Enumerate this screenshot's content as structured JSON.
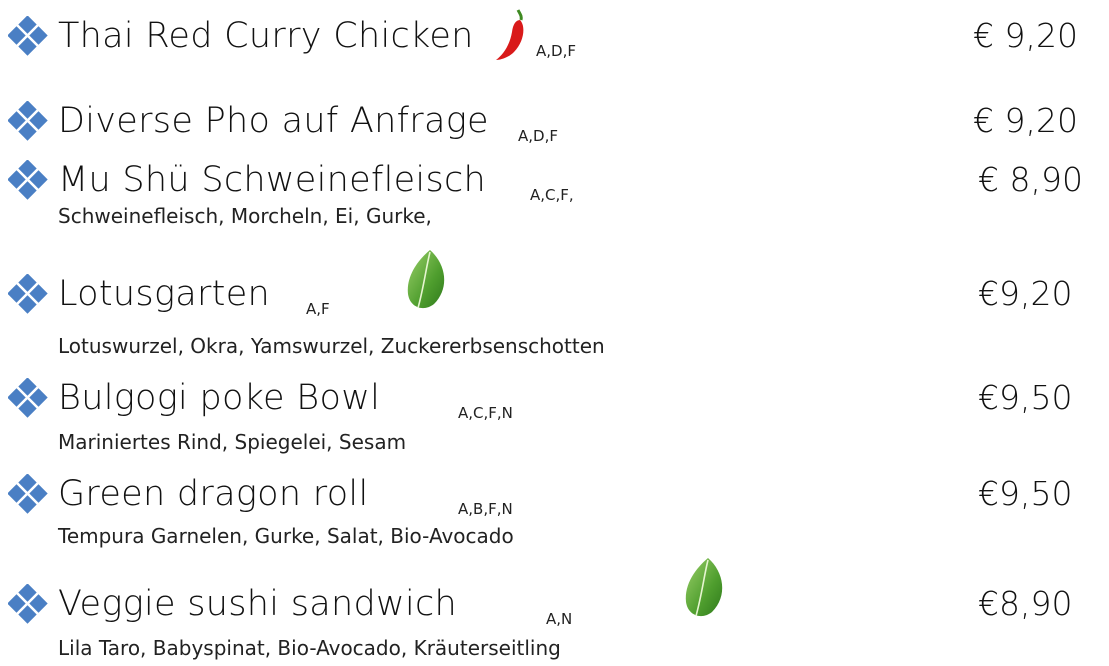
{
  "colors": {
    "bullet": "#4a7fc4",
    "chili": "#d91a1a",
    "leaf": "#5fae3a"
  },
  "items": [
    {
      "name": "Thai Red Curry Chicken",
      "allergens": "A,D,F",
      "price": "€ 9,20",
      "icon": "chili-icon"
    },
    {
      "name": "Diverse Pho auf Anfrage",
      "allergens": "A,D,F",
      "price": "€ 9,20"
    },
    {
      "name": "Mu Shü Schweinefleisch",
      "allergens": "A,C,F,",
      "price": "€ 8,90",
      "description": "Schweinefleisch, Morcheln, Ei, Gurke,"
    },
    {
      "name": "Lotusgarten",
      "allergens": "A,F",
      "price": "€9,20",
      "icon": "leaf-icon",
      "description": "Lotuswurzel, Okra, Yamswurzel, Zuckererbsenschotten"
    },
    {
      "name": "Bulgogi poke Bowl",
      "allergens": "A,C,F,N",
      "price": "€9,50",
      "description": "Mariniertes Rind, Spiegelei, Sesam"
    },
    {
      "name": "Green dragon roll",
      "allergens": "A,B,F,N",
      "price": "€9,50",
      "description": "Tempura Garnelen, Gurke, Salat, Bio-Avocado"
    },
    {
      "name": "Veggie sushi sandwich",
      "allergens": "A,N",
      "price": "€8,90",
      "icon": "leaf-icon",
      "description": "Lila Taro, Babyspinat, Bio-Avocado, Kräuterseitling"
    }
  ]
}
